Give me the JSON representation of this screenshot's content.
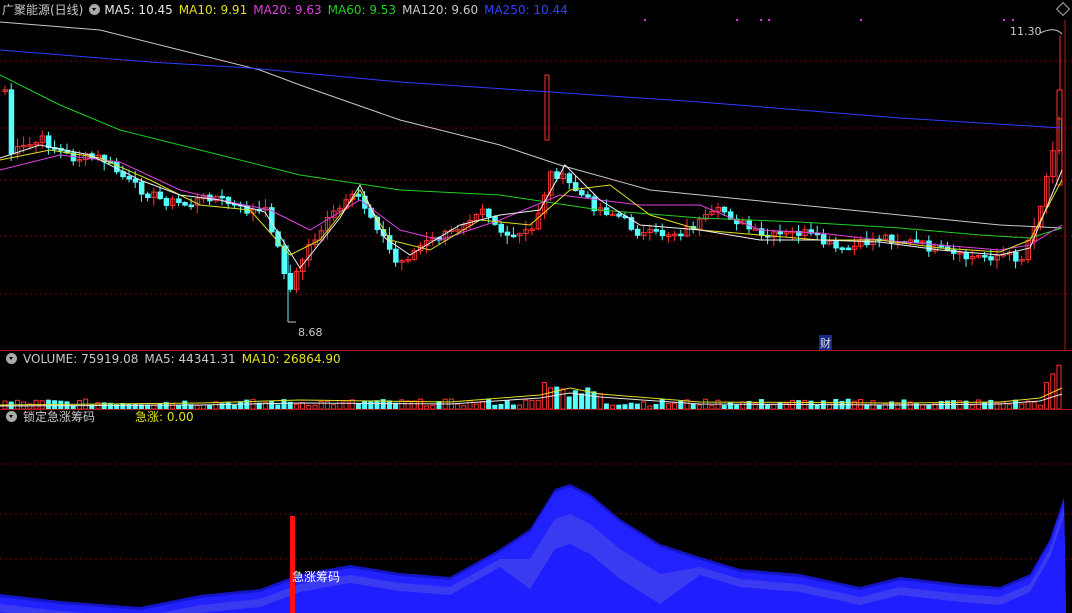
{
  "main_panel": {
    "title": "广聚能源(日线)",
    "ma": [
      {
        "label": "MA5: 10.45",
        "color": "#e8e8e8"
      },
      {
        "label": "MA10: 9.91",
        "color": "#e0e020"
      },
      {
        "label": "MA20: 9.63",
        "color": "#e040e0"
      },
      {
        "label": "MA60: 9.53",
        "color": "#20d020"
      },
      {
        "label": "MA120: 9.60",
        "color": "#c8c8c8"
      },
      {
        "label": "MA250: 10.44",
        "color": "#3040ff"
      }
    ],
    "high_label": "11.30",
    "low_label": "8.68",
    "marker_label": "财"
  },
  "volume_panel": {
    "title": "VOLUME: 75919.08",
    "ma5": "MA5: 44341.31",
    "ma10": "MA10: 26864.90"
  },
  "indicator_panel": {
    "title": "锁定急涨筹码",
    "value_label": "急涨: 0.00",
    "annotation": "急涨筹码"
  },
  "colors": {
    "up": "#ff3030",
    "down": "#54ffff",
    "grid": "#7a0000",
    "separator": "#b01818",
    "chip_fill": "#1a1aff"
  }
}
